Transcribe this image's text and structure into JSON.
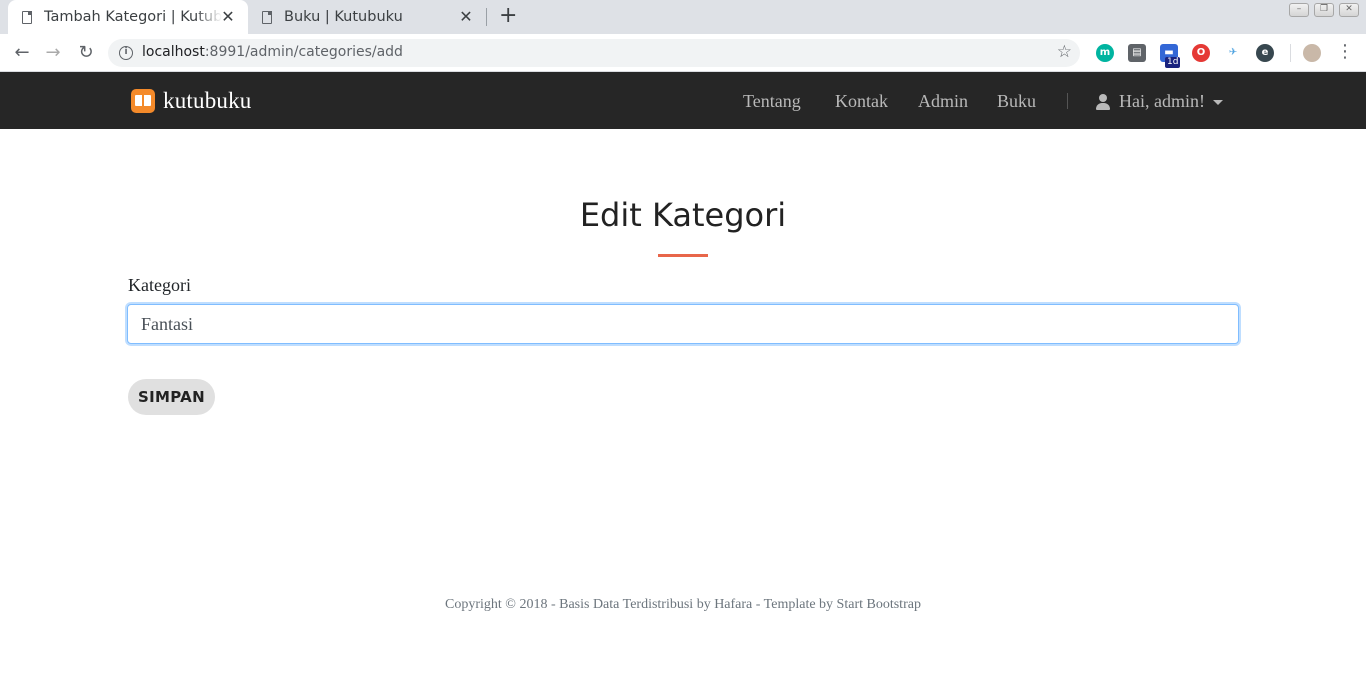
{
  "browser": {
    "tabs": [
      {
        "title": "Tambah Kategori | Kutubuku",
        "active": true
      },
      {
        "title": "Buku | Kutubuku",
        "active": false
      }
    ],
    "close_glyph": "✕",
    "new_tab_glyph": "+",
    "url_host": "localhost",
    "url_rest": ":8991/admin/categories/add",
    "window_controls": [
      "–",
      "❐",
      "✕"
    ],
    "extensions": [
      {
        "icon": "m",
        "color": "#00b4a0"
      },
      {
        "icon": "▤",
        "color": "#5f6368"
      },
      {
        "icon": "▬",
        "color": "#3367d6"
      },
      {
        "icon": "O",
        "color": "#e53935"
      },
      {
        "icon": "✈",
        "color": "#4fa3e0"
      },
      {
        "icon": "e",
        "color": "#37474f"
      }
    ],
    "extension_badge": "1d"
  },
  "site": {
    "brand": "kutubuku",
    "nav": [
      "Tentang",
      "Kontak",
      "Admin",
      "Buku"
    ],
    "user_greeting": "Hai, admin!",
    "accent_color": "#e8664a",
    "navbar_color": "#262626"
  },
  "form": {
    "heading": "Edit Kategori",
    "label": "Kategori",
    "value": "Fantasi",
    "submit_label": "SIMPAN"
  },
  "footer": {
    "text": "Copyright © 2018 - Basis Data Terdistribusi by Hafara - Template by Start Bootstrap"
  }
}
